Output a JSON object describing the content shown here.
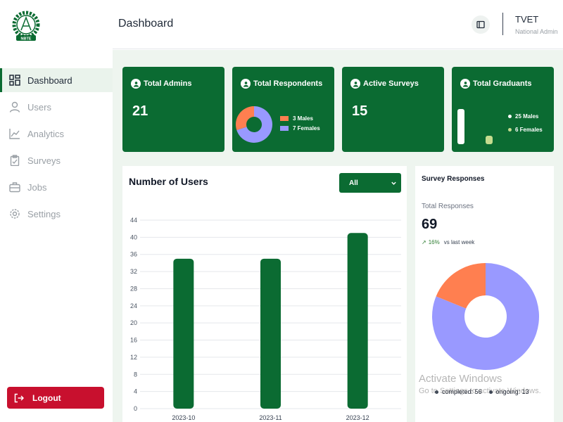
{
  "brand": {
    "logo_text": "NBTE"
  },
  "sidebar": {
    "items": [
      {
        "label": "Dashboard",
        "icon": "grid-icon",
        "active": true
      },
      {
        "label": "Users",
        "icon": "user-icon",
        "active": false
      },
      {
        "label": "Analytics",
        "icon": "chart-line-icon",
        "active": false
      },
      {
        "label": "Surveys",
        "icon": "clipboard-icon",
        "active": false
      },
      {
        "label": "Jobs",
        "icon": "briefcase-icon",
        "active": false
      },
      {
        "label": "Settings",
        "icon": "gear-icon",
        "active": false
      }
    ],
    "logout_label": "Logout"
  },
  "header": {
    "title": "Dashboard",
    "user_name": "TVET",
    "user_role": "National Admin"
  },
  "cards": {
    "admins": {
      "label": "Total Admins",
      "value": "21"
    },
    "respondents": {
      "label": "Total Respondents",
      "legend": [
        "3 Males",
        "7 Females"
      ],
      "males": 3,
      "females": 7
    },
    "surveys": {
      "label": "Active Surveys",
      "value": "15"
    },
    "graduants": {
      "label": "Total Graduants",
      "legend": [
        "25 Males",
        "6 Females"
      ],
      "males": 25,
      "females": 6
    }
  },
  "users_panel": {
    "title": "Number of Users",
    "filter_value": "All"
  },
  "survey_panel": {
    "title": "Survey Responses",
    "subtitle": "Total Responses",
    "total": "69",
    "change": "16%",
    "change_suffix": "vs last week",
    "legend": [
      "completed: 56",
      "ongoing: 13"
    ]
  },
  "colors": {
    "primary": "#0b6b32",
    "danger": "#c8102e",
    "orange": "#ff7f50",
    "lavender": "#9999ff",
    "light_green": "#c5dc8f"
  },
  "chart_data": [
    {
      "type": "bar",
      "categories": [
        "2023-10",
        "2023-11",
        "2023-12"
      ],
      "values": [
        35,
        35,
        41
      ],
      "yticks": [
        0,
        4,
        8,
        12,
        16,
        20,
        24,
        28,
        32,
        36,
        40,
        44
      ],
      "ylim": [
        0,
        44
      ],
      "grid": true
    },
    {
      "type": "pie",
      "labels": [
        "completed",
        "ongoing"
      ],
      "values": [
        56,
        13
      ],
      "donut": true
    }
  ],
  "watermark": {
    "line1": "Activate Windows",
    "line2": "Go to Settings to activate Windows."
  }
}
